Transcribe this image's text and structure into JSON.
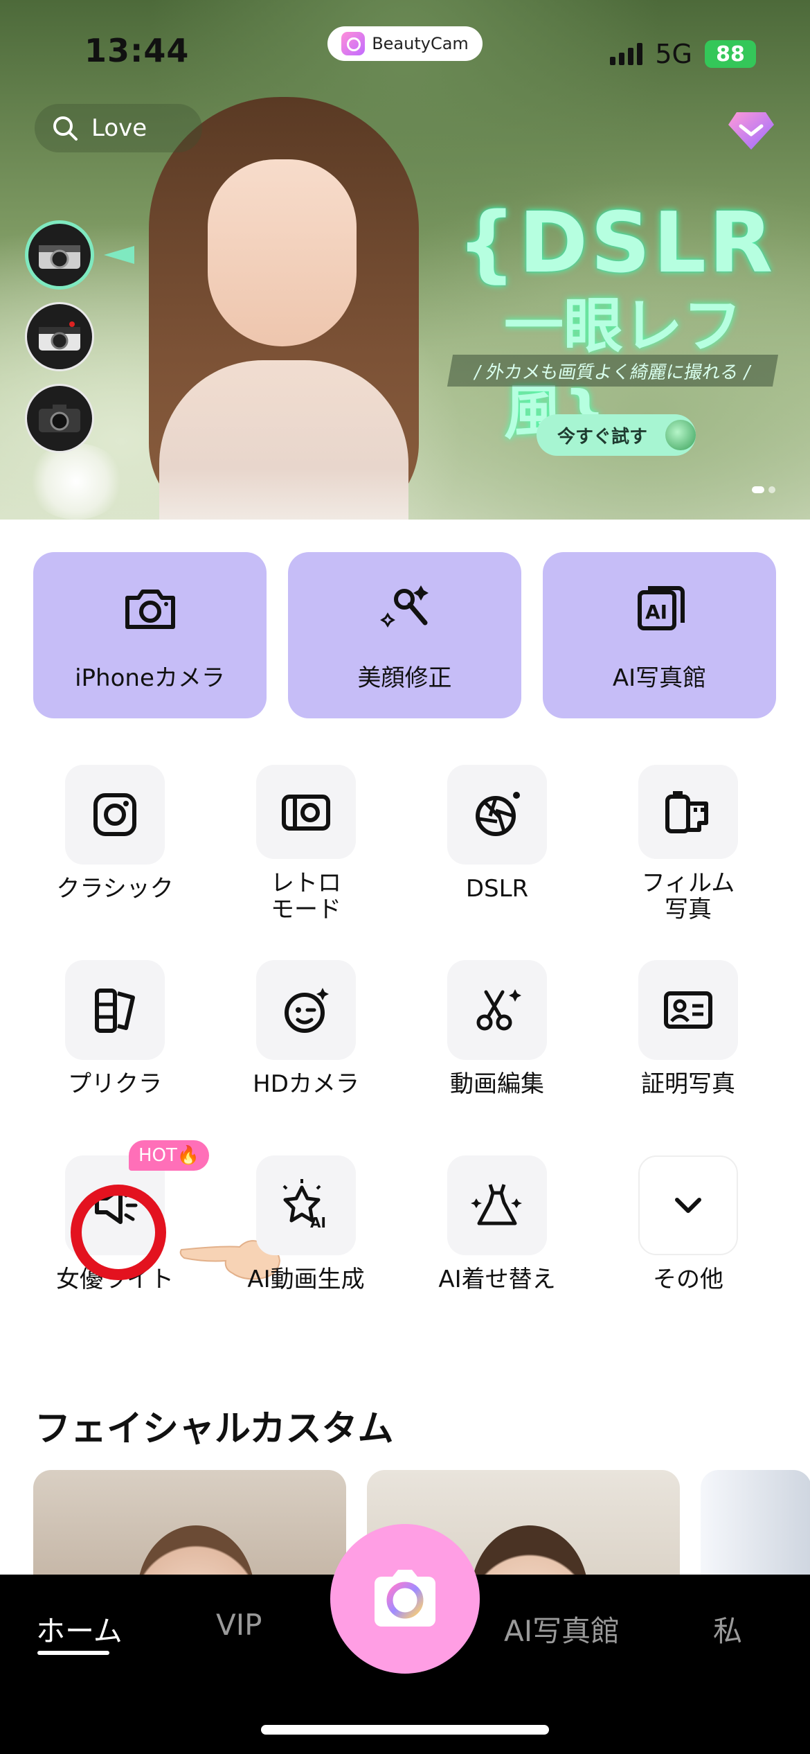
{
  "status_bar": {
    "time": "13:44",
    "network": "5G",
    "battery": "88"
  },
  "app_pill": {
    "name": "BeautyCam"
  },
  "search": {
    "placeholder": "Love"
  },
  "promo": {
    "title": "{DSLR",
    "subtitle": "一眼レフ風}",
    "tagline": "/ 外カメも画質よく綺麗に撮れる /",
    "cta": "今すぐ試す"
  },
  "big_features": [
    {
      "label": "iPhoneカメラ",
      "icon": "camera-icon"
    },
    {
      "label": "美顔修正",
      "icon": "makeup-brush-icon"
    },
    {
      "label": "AI写真館",
      "icon": "ai-photo-icon"
    }
  ],
  "tools": [
    {
      "label": "クラシック",
      "icon": "instagram-camera-icon"
    },
    {
      "label": "レトロ\nモード",
      "icon": "retro-camera-icon"
    },
    {
      "label": "DSLR",
      "icon": "aperture-icon"
    },
    {
      "label": "フィルム\n写真",
      "icon": "film-roll-icon"
    },
    {
      "label": "プリクラ",
      "icon": "photo-strip-icon"
    },
    {
      "label": "HDカメラ",
      "icon": "wink-face-icon"
    },
    {
      "label": "動画編集",
      "icon": "scissors-icon"
    },
    {
      "label": "証明写真",
      "icon": "id-card-icon"
    },
    {
      "label": "女優ライト",
      "icon": "light-icon",
      "badge": "HOT🔥"
    },
    {
      "label": "AI動画生成",
      "icon": "ai-sparkle-icon"
    },
    {
      "label": "AI着せ替え",
      "icon": "dress-icon"
    },
    {
      "label": "その他",
      "icon": "chevron-down-icon"
    }
  ],
  "section": {
    "title": "フェイシャルカスタム"
  },
  "tabbar": {
    "home": "ホーム",
    "vip": "VIP",
    "ai_studio": "AI写真館",
    "me": "私"
  },
  "colors": {
    "card_purple": "#c6bdf7",
    "tile_gray": "#f4f4f6",
    "fab_pink": "#ff9ee4",
    "hot_badge": "#ff6fb8",
    "promo_mint": "#b6ffe0"
  }
}
